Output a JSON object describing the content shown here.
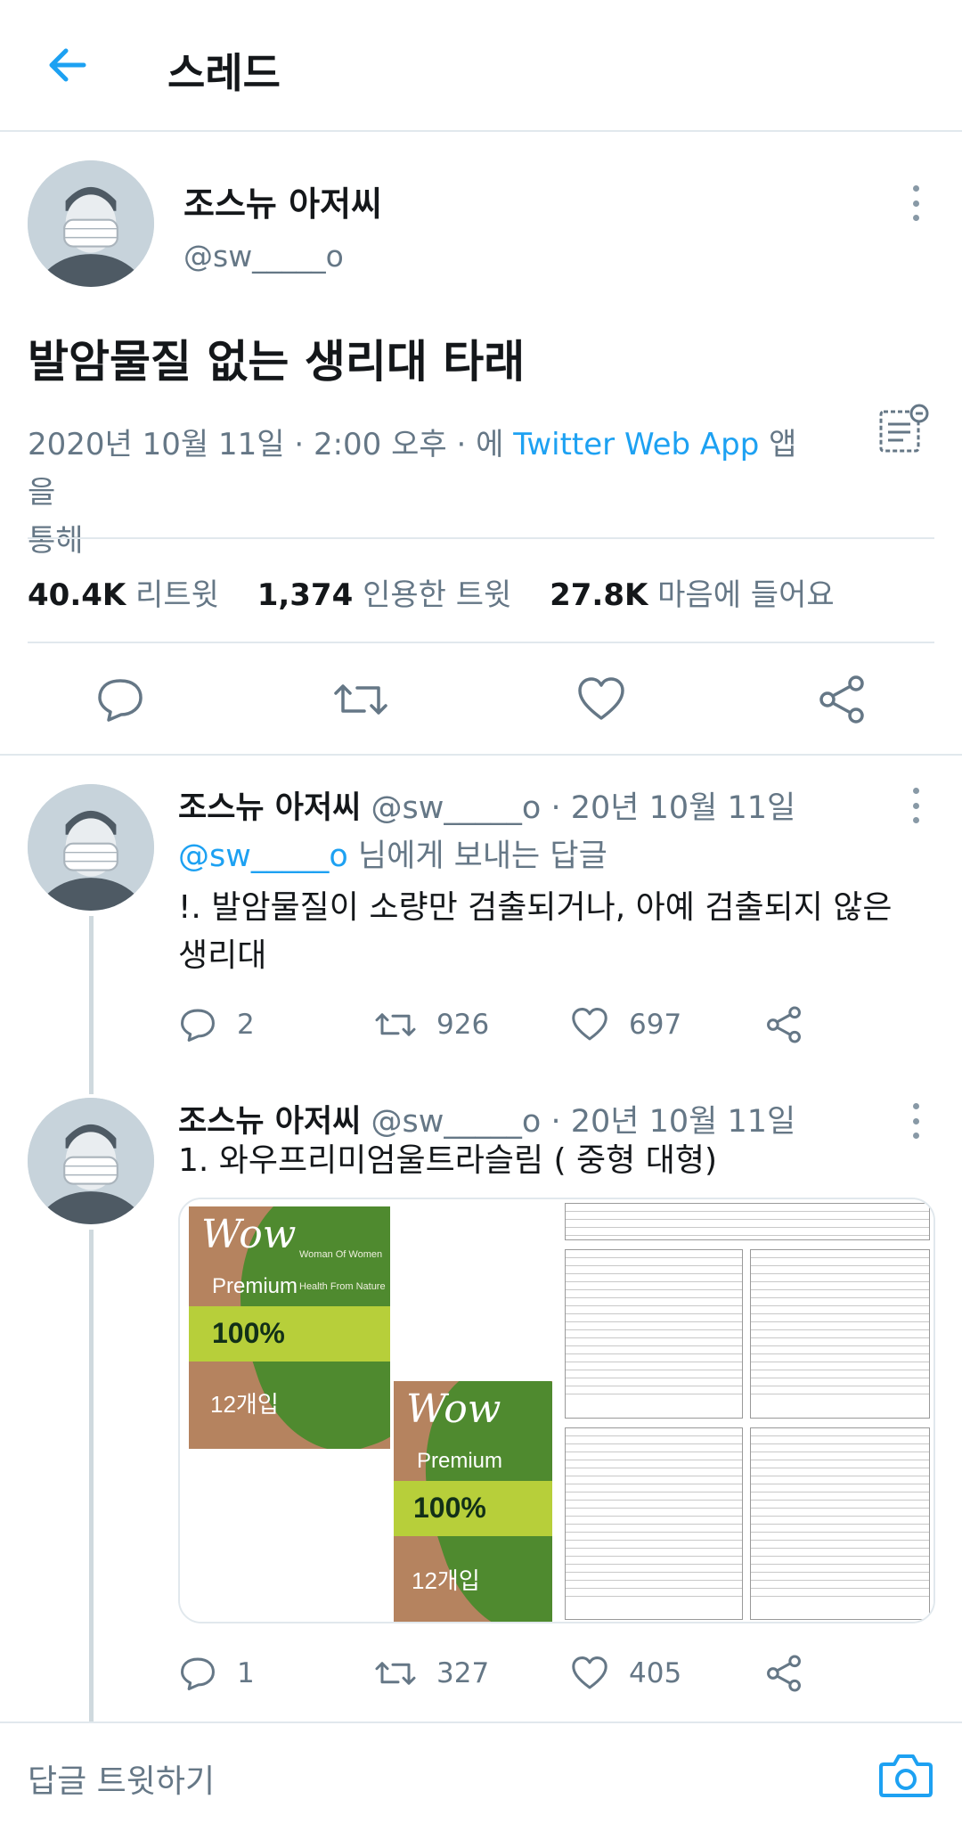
{
  "header": {
    "title": "스레드",
    "back_icon": "arrow-left-icon"
  },
  "main_tweet": {
    "author_name": "조스뉴 아저씨",
    "handle": "@sw_____o",
    "text": "발암물질 없는 생리대 타래",
    "date": "2020년 10월 11일",
    "time": "2:00 오후",
    "via_prefix": "에",
    "app": "Twitter Web App",
    "via_suffix_1": "앱을",
    "via_suffix_2": "통해",
    "stats": {
      "retweets_value": "40.4K",
      "retweets_label": "리트윗",
      "quotes_value": "1,374",
      "quotes_label": "인용한 트윗",
      "likes_value": "27.8K",
      "likes_label": "마음에 들어요"
    }
  },
  "replies": [
    {
      "author_name": "조스뉴 아저씨",
      "handle": "@sw_____o",
      "date": "20년 10월 11일",
      "reply_to_mention": "@sw_____o",
      "reply_to_suffix": "님에게 보내는 답글",
      "text": "!. 발암물질이 소량만 검출되거나, 아예 검출되지 않은 생리대",
      "counts": {
        "replies": "2",
        "retweets": "926",
        "likes": "697"
      }
    },
    {
      "author_name": "조스뉴 아저씨",
      "handle": "@sw_____o",
      "date": "20년 10월 11일",
      "text": "1. 와우프리미엄울트라슬림 ( 중형 대형)",
      "counts": {
        "replies": "1",
        "retweets": "327",
        "likes": "405"
      },
      "media": {
        "package_brand": "Wow",
        "package_tagline_1": "Woman Of Women",
        "package_tagline_2": "Health From Nature",
        "package_line": "Premium",
        "package_percent": "100%",
        "package_count": "12개입"
      }
    }
  ],
  "footer": {
    "compose_placeholder": "답글 트윗하기",
    "camera_icon": "camera-icon"
  },
  "colors": {
    "accent": "#1da1f2",
    "secondary_text": "#657786",
    "divider": "#e1e8ed"
  }
}
